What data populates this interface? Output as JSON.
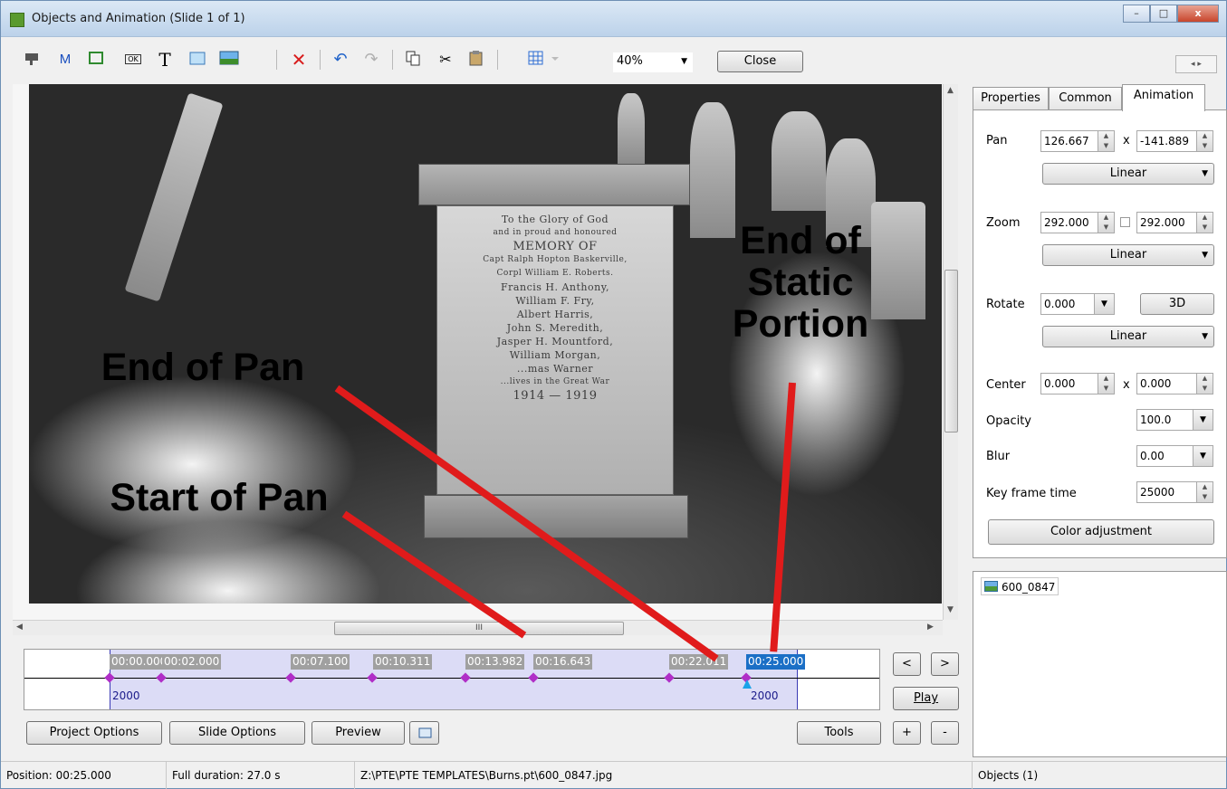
{
  "window": {
    "title": "Objects and Animation  (Slide 1 of 1)",
    "buttons": {
      "minimize": "–",
      "maximize": "□",
      "close": "x"
    }
  },
  "toolbar": {
    "zoom": "40%",
    "close_label": "Close",
    "icons": [
      "slideshow-icon",
      "mask-icon",
      "frame-icon",
      "button-icon",
      "text-icon",
      "rectangle-icon",
      "image-icon",
      "delete-icon",
      "undo-icon",
      "redo-icon",
      "copy-icon",
      "cut-icon",
      "paste-icon",
      "grid-icon"
    ],
    "m_label": "M",
    "t_label": "T",
    "ok_label": "OK"
  },
  "canvas": {
    "annotations": {
      "end_of_pan": "End of Pan",
      "start_of_pan": "Start of Pan",
      "end_static": "End of Static Portion",
      "end_static_l1": "End of",
      "end_static_l2": "Static",
      "end_static_l3": "Portion"
    },
    "inscription": [
      "To the Glory of God",
      "and in proud and honoured",
      "MEMORY OF",
      "Capt Ralph Hopton Baskerville,",
      "Corpl William E. Roberts.",
      "Francis H. Anthony,",
      "William F. Fry,",
      "Albert Harris,",
      "John S. Meredith,",
      "Jasper H. Mountford,",
      "William Morgan,",
      "...mas Warner",
      "...lives in the Great War",
      "1914 — 1919"
    ]
  },
  "scrollbar": {
    "grip": "III"
  },
  "timeline": {
    "labels": [
      "00:00.000",
      "00:02.000",
      "00:07.100",
      "00:10.311",
      "00:13.982",
      "00:16.643",
      "00:22.011",
      "00:25.000"
    ],
    "active_label": "00:25.000",
    "durations": [
      "2000",
      "2000"
    ],
    "prev_label": "<",
    "next_label": ">",
    "play_label": "Play",
    "plus_label": "+",
    "minus_label": "-"
  },
  "bottom_buttons": {
    "project_options": "Project Options",
    "slide_options": "Slide Options",
    "preview": "Preview",
    "tools": "Tools"
  },
  "panel": {
    "tabs": [
      "Properties",
      "Common",
      "Animation"
    ],
    "active_tab": "Animation",
    "pan": {
      "label": "Pan",
      "x": "126.667",
      "sep": "x",
      "y": "-141.889",
      "mode": "Linear"
    },
    "zoom": {
      "label": "Zoom",
      "x": "292.000",
      "y": "292.000",
      "mode": "Linear"
    },
    "rotate": {
      "label": "Rotate",
      "value": "0.000",
      "btn3d": "3D",
      "mode": "Linear"
    },
    "center": {
      "label": "Center",
      "x": "0.000",
      "sep": "x",
      "y": "0.000"
    },
    "opacity": {
      "label": "Opacity",
      "value": "100.0"
    },
    "blur": {
      "label": "Blur",
      "value": "0.00"
    },
    "keyframe": {
      "label": "Key frame time",
      "value": "25000"
    },
    "color_adjustment": "Color adjustment"
  },
  "objects": {
    "items": [
      "600_0847"
    ]
  },
  "status": {
    "position": "Position: 00:25.000",
    "duration": "Full duration:  27.0 s",
    "path": "Z:\\PTE\\PTE TEMPLATES\\Burns.pt\\600_0847.jpg",
    "objects": "Objects (1)"
  },
  "colors": {
    "accent": "#1b6fc6",
    "keyframe": "#b02ec7",
    "selection": "#dcdcf6",
    "annotation_line": "#e01b1b"
  }
}
